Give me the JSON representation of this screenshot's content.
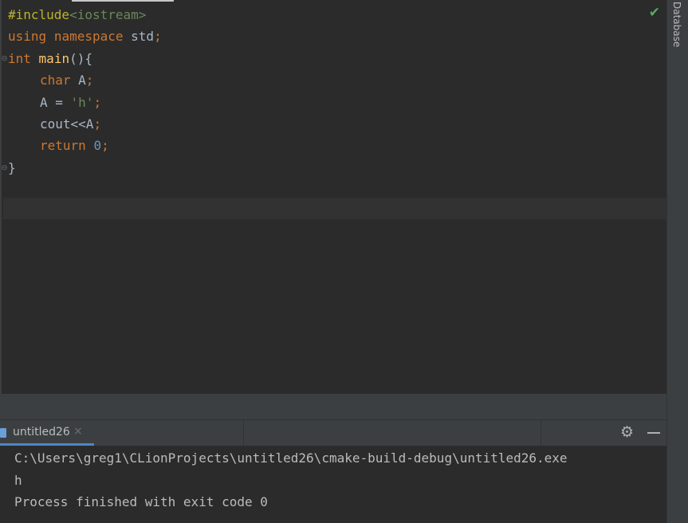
{
  "editor": {
    "code": {
      "l1_directive": "#include",
      "l1_header": "<iostream>",
      "l2_using": "using",
      "l2_namespace": "namespace",
      "l2_std": "std",
      "l2_semi": ";",
      "l3_type": "int",
      "l3_fn": "main",
      "l3_rest": "(){",
      "l4_type": "char",
      "l4_rest": " A",
      "l4_semi": ";",
      "l5_lhs": "A = ",
      "l5_str": "'h'",
      "l5_semi": ";",
      "l6_expr": "cout<<A",
      "l6_semi": ";",
      "l7_kw": "return",
      "l7_num": "0",
      "l7_semi": ";",
      "l8_brace": "}"
    },
    "status_icon": "check-icon"
  },
  "right_strip": {
    "label": "Database"
  },
  "run_panel": {
    "tab_label": "untitled26",
    "tab_close": "×",
    "settings_icon": "gear-icon",
    "minimize_icon": "minimize-icon",
    "output": [
      "C:\\Users\\greg1\\CLionProjects\\untitled26\\cmake-build-debug\\untitled26.exe",
      "h",
      "Process finished with exit code 0"
    ]
  },
  "colors": {
    "background": "#2b2b2b",
    "keyword": "#cc7832",
    "function": "#ffc66d",
    "string": "#6a8759",
    "number": "#6897bb",
    "accent": "#4a88c7",
    "success": "#59a869"
  }
}
